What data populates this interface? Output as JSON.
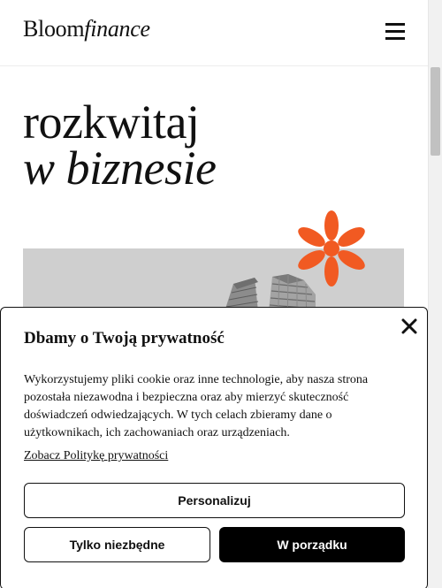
{
  "header": {
    "logo_main": "Bloom",
    "logo_accent": "finance",
    "menu_icon": "hamburger-menu-icon"
  },
  "hero": {
    "title_line1": "rozkwitaj",
    "title_line2": "w biznesie",
    "decoration_icon": "asterisk-flower-icon",
    "accent_color": "#f15a22"
  },
  "cookie_banner": {
    "title": "Dbamy o Twoją prywatność",
    "body": "Wykorzystujemy pliki cookie oraz inne technologie, aby nasza strona pozostała niezawodna i bezpieczna oraz aby mierzyć skuteczność doświadczeń odwiedzających. W tych celach zbieramy dane o użytkownikach, ich zachowaniach oraz urządzeniach.",
    "policy_link": "Zobacz Politykę prywatności",
    "close_icon": "close-icon",
    "buttons": {
      "personalize": "Personalizuj",
      "necessary_only": "Tylko niezbędne",
      "accept": "W porządku"
    }
  }
}
